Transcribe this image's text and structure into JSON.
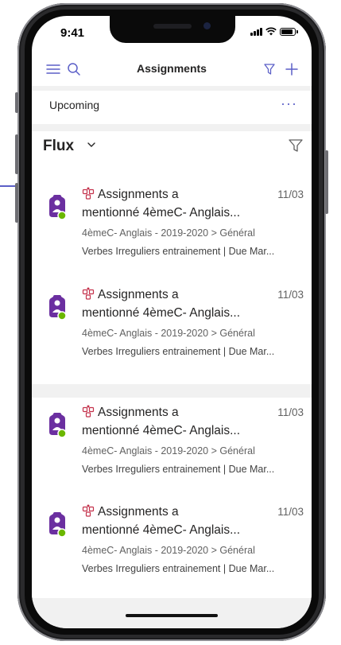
{
  "status_bar": {
    "time": "9:41"
  },
  "app_bar": {
    "title": "Assignments"
  },
  "section": {
    "label": "Upcoming",
    "more": "···"
  },
  "feed": {
    "title": "Flux"
  },
  "items": [
    {
      "line1": "Assignments a",
      "line2": "mentionné 4èmeC- Anglais...",
      "date": "11/03",
      "path": "4èmeC- Anglais - 2019-2020 > Général",
      "detail": "Verbes Irreguliers entrainement | Due Mar..."
    },
    {
      "line1": "Assignments a",
      "line2": "mentionné 4èmeC- Anglais...",
      "date": "11/03",
      "path": "4èmeC- Anglais - 2019-2020 > Général",
      "detail": "Verbes Irreguliers entrainement | Due Mar..."
    },
    {
      "line1": "Assignments a",
      "line2": "mentionné 4èmeC- Anglais...",
      "date": "11/03",
      "path": "4èmeC- Anglais - 2019-2020 > Général",
      "detail": "Verbes Irreguliers entrainement | Due Mar..."
    },
    {
      "line1": "Assignments a",
      "line2": "mentionné 4èmeC- Anglais...",
      "date": "11/03",
      "path": "4èmeC- Anglais - 2019-2020 > Général",
      "detail": "Verbes Irreguliers entrainement | Due Mar..."
    }
  ],
  "colors": {
    "accent": "#5b5fc7",
    "avatar": "#6b2fa0",
    "status_ok": "#6bb700",
    "app_icon": "#c4314b"
  },
  "icons": {
    "menu": "hamburger-icon",
    "search": "search-icon",
    "filter": "filter-icon",
    "add": "plus-icon",
    "chevron": "chevron-down-icon",
    "more": "more-icon"
  }
}
